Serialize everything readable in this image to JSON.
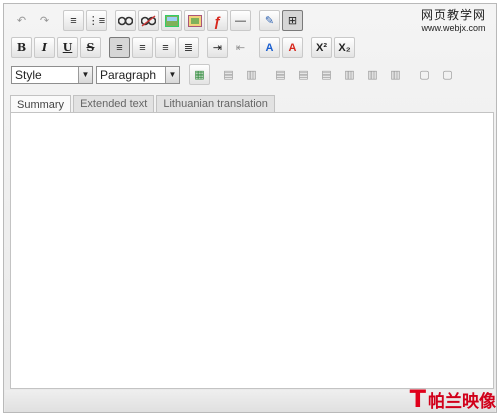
{
  "toolbar_row1": [
    {
      "name": "undo-button",
      "glyph": "↶",
      "state": "disabled"
    },
    {
      "name": "redo-button",
      "glyph": "↷",
      "state": "disabled"
    },
    {
      "name": "ordered-list-button",
      "glyph": "≡",
      "state": "normal"
    },
    {
      "name": "unordered-list-button",
      "glyph": "⋮≡",
      "state": "normal"
    },
    {
      "name": "insert-link-button",
      "glyph": "🔗",
      "state": "normal"
    },
    {
      "name": "unlink-button",
      "glyph": "⛓",
      "state": "normal"
    },
    {
      "name": "insert-image-button",
      "glyph": "▣",
      "state": "normal"
    },
    {
      "name": "image-manager-button",
      "glyph": "▦",
      "state": "normal"
    },
    {
      "name": "insert-flash-button",
      "glyph": "ƒ",
      "state": "normal"
    },
    {
      "name": "horizontal-rule-button",
      "glyph": "—",
      "state": "normal"
    },
    {
      "name": "edit-source-button",
      "glyph": "✎",
      "state": "normal"
    },
    {
      "name": "show-blocks-button",
      "glyph": "⊞",
      "state": "active"
    }
  ],
  "toolbar_row2": [
    {
      "name": "bold-button",
      "glyph": "B",
      "state": "normal"
    },
    {
      "name": "italic-button",
      "glyph": "I",
      "state": "normal"
    },
    {
      "name": "underline-button",
      "glyph": "U",
      "state": "normal"
    },
    {
      "name": "strikethrough-button",
      "glyph": "S",
      "state": "normal"
    },
    {
      "name": "align-left-button",
      "glyph": "≡",
      "state": "active"
    },
    {
      "name": "align-center-button",
      "glyph": "≡",
      "state": "normal"
    },
    {
      "name": "align-right-button",
      "glyph": "≡",
      "state": "normal"
    },
    {
      "name": "align-justify-button",
      "glyph": "≣",
      "state": "normal"
    },
    {
      "name": "indent-button",
      "glyph": "⇥",
      "state": "normal"
    },
    {
      "name": "outdent-button",
      "glyph": "⇤",
      "state": "disabled"
    },
    {
      "name": "text-color-button",
      "glyph": "A",
      "state": "normal"
    },
    {
      "name": "background-color-button",
      "glyph": "A",
      "state": "normal"
    },
    {
      "name": "superscript-button",
      "glyph": "X²",
      "state": "normal"
    },
    {
      "name": "subscript-button",
      "glyph": "X₂",
      "state": "normal"
    }
  ],
  "toolbar_row3": {
    "style_select": "Style",
    "format_select": "Paragraph",
    "buttons": [
      {
        "name": "insert-table-button",
        "glyph": "▦",
        "state": "normal"
      },
      {
        "name": "row-props-button",
        "glyph": "▤",
        "state": "disabled"
      },
      {
        "name": "cell-props-button",
        "glyph": "▥",
        "state": "disabled"
      },
      {
        "name": "insert-row-before-button",
        "glyph": "▤",
        "state": "disabled"
      },
      {
        "name": "insert-row-after-button",
        "glyph": "▤",
        "state": "disabled"
      },
      {
        "name": "delete-row-button",
        "glyph": "▤",
        "state": "disabled"
      },
      {
        "name": "insert-col-before-button",
        "glyph": "▥",
        "state": "disabled"
      },
      {
        "name": "insert-col-after-button",
        "glyph": "▥",
        "state": "disabled"
      },
      {
        "name": "delete-col-button",
        "glyph": "▥",
        "state": "disabled"
      },
      {
        "name": "split-cells-button",
        "glyph": "▢",
        "state": "disabled"
      },
      {
        "name": "merge-cells-button",
        "glyph": "▢",
        "state": "disabled"
      }
    ]
  },
  "tabs": [
    {
      "label": "Summary",
      "active": true
    },
    {
      "label": "Extended text",
      "active": false
    },
    {
      "label": "Lithuanian translation",
      "active": false
    }
  ],
  "watermark_top": {
    "line1": "网页教学网",
    "line2": "www.webjx.com"
  },
  "watermark_bottom": {
    "logo": "T",
    "text": "帕兰映像"
  },
  "colors": {
    "accent_red": "#e0001b",
    "toolbar_bg": "#ececec",
    "border": "#b9b9b9"
  }
}
